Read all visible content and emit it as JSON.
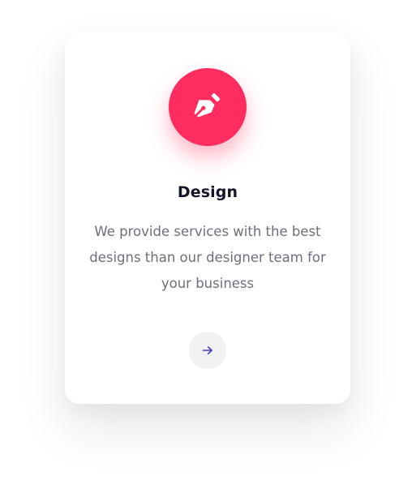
{
  "card": {
    "title": "Design",
    "description": "We provide services with the best designs than our designer team for your business",
    "icon": "pen-nib-icon",
    "action_icon": "arrow-right-icon"
  },
  "colors": {
    "accent": "#ff2d5f",
    "title": "#14142b",
    "text": "#6e6e7a",
    "arrow": "#4b3bd6",
    "button_bg": "#f1f1f4"
  }
}
